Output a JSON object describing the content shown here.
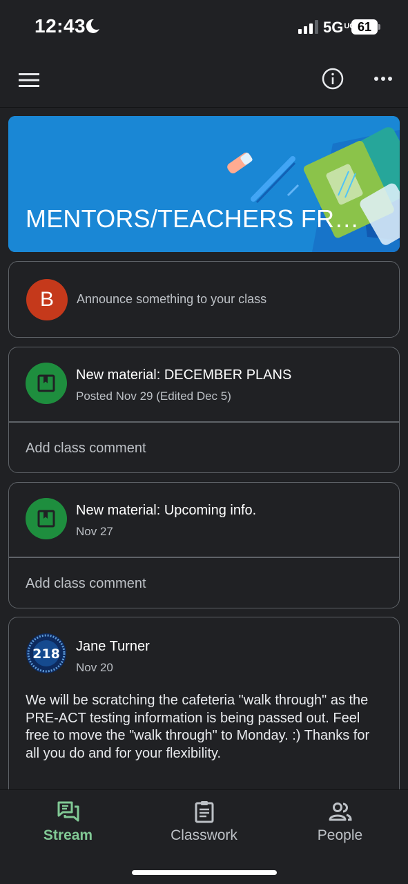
{
  "status_bar": {
    "time": "12:43",
    "network": "5G",
    "network_suffix": "UC",
    "battery": "61"
  },
  "app_bar": {
    "menu_icon": "menu-icon",
    "info_icon": "info-icon",
    "more_icon": "more-horiz-icon"
  },
  "banner": {
    "title": "MENTORS/TEACHERS FRESH..."
  },
  "announce": {
    "avatar_letter": "B",
    "placeholder": "Announce something to your class"
  },
  "posts": [
    {
      "title": "New material: DECEMBER PLANS",
      "subtitle": "Posted Nov 29 (Edited Dec 5)",
      "comment": "Add class comment"
    },
    {
      "title": "New material: Upcoming info.",
      "subtitle": "Nov 27",
      "comment": "Add class comment"
    }
  ],
  "announcement": {
    "author": "Jane Turner",
    "date": "Nov 20",
    "logo_text": "218",
    "body": "We will be scratching the cafeteria \"walk through\" as the PRE-ACT testing information is being passed out.  Feel free to move the \"walk through\" to Monday. :) Thanks for all you do and for your flexibility."
  },
  "bottom_nav": [
    {
      "label": "Stream",
      "icon": "stream-icon",
      "active": true
    },
    {
      "label": "Classwork",
      "icon": "classwork-icon",
      "active": false
    },
    {
      "label": "People",
      "icon": "people-icon",
      "active": false
    }
  ],
  "colors": {
    "background": "#202124",
    "accent": "#81c995",
    "material_green": "#1e8e3e",
    "avatar_red": "#c5391b",
    "banner_blue": "#1a87d5"
  }
}
